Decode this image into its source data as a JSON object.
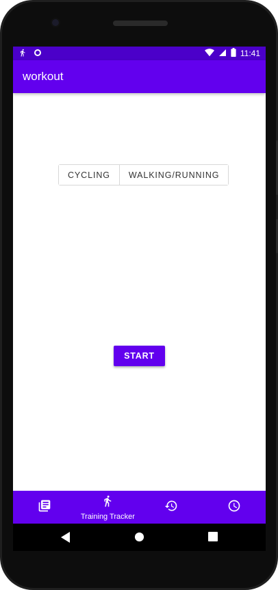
{
  "status_bar": {
    "time": "11:41",
    "icons_left": [
      "running-figure-icon",
      "circle-sync-icon"
    ],
    "icons_right": [
      "wifi-icon",
      "signal-icon",
      "battery-icon"
    ]
  },
  "app_bar": {
    "title": "workout"
  },
  "activity_toggle": {
    "options": [
      "CYCLING",
      "WALKING/RUNNING"
    ]
  },
  "start_button": {
    "label": "START"
  },
  "bottom_nav": {
    "items": [
      {
        "icon": "library-icon",
        "label": ""
      },
      {
        "icon": "running-figure-icon",
        "label": "Training Tracker",
        "selected": true
      },
      {
        "icon": "history-icon",
        "label": ""
      },
      {
        "icon": "clock-icon",
        "label": ""
      }
    ]
  },
  "colors": {
    "primary": "#6200ee",
    "primary_dark": "#4b00c9",
    "surface": "#ffffff"
  }
}
